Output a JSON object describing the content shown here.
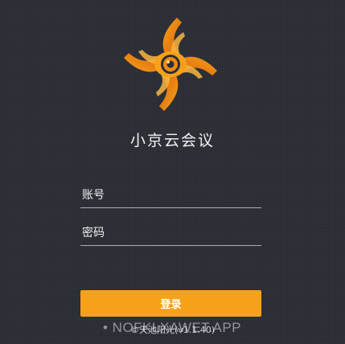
{
  "app": {
    "title": "小京云会议"
  },
  "login_form": {
    "account_placeholder": "账号",
    "password_placeholder": "密码",
    "login_label": "登录"
  },
  "footer": {
    "copyright": "©天池阳光(v1.1.40)",
    "watermark": "• NOFKLXAWET.APP"
  },
  "colors": {
    "background": "#2c2f36",
    "accent": "#f6a11a",
    "logo_orange": "#f08a12",
    "logo_dark_orange": "#d85f0a",
    "input_underline": "#a9acb3"
  },
  "icons": {
    "logo": "pinwheel-eye-logo-icon"
  }
}
